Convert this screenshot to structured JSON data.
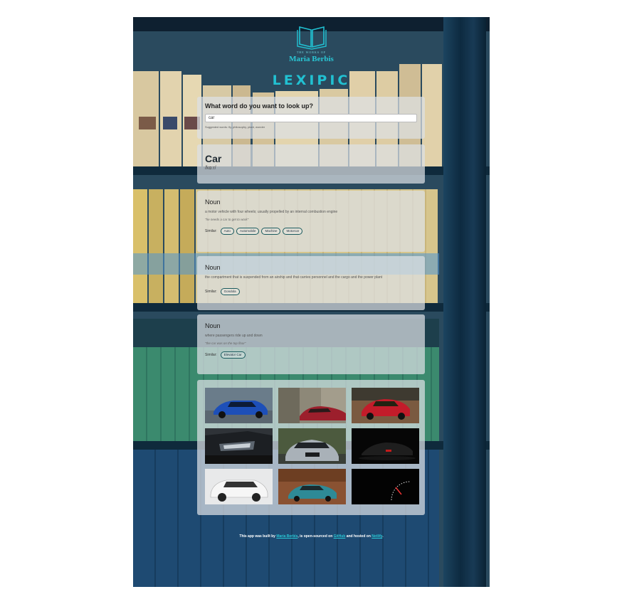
{
  "brand": {
    "small_text": "THE WORKS OF",
    "name": "Maria Berbis",
    "logo_icon": "open-book-icon",
    "color": "#21c1d2"
  },
  "title": "LEXIPIC",
  "search": {
    "question": "What word do you want to look up?",
    "value": "car",
    "suggestions": "Suggested words: fly, philosophy, plant, wonder"
  },
  "word": {
    "text": "Car",
    "phonetic": "/kɑːr/"
  },
  "definitions": [
    {
      "pos": "Noun",
      "definition": "a motor vehicle with four wheels; usually propelled by an internal combustion engine",
      "example": "\"he needs a car to get to work\"",
      "similar_label": "Similar:",
      "synonyms": [
        "Auto",
        "Automobile",
        "Machine",
        "Motorcar"
      ]
    },
    {
      "pos": "Noun",
      "definition": "the compartment that is suspended from an airship and that carries personnel and the cargo and the power plant",
      "example": "",
      "similar_label": "Similar:",
      "synonyms": [
        "Gondola"
      ]
    },
    {
      "pos": "Noun",
      "definition": "where passengers ride up and down",
      "example": "\"the car was on the top floor\"",
      "similar_label": "Similar:",
      "synonyms": [
        "Elevator Car"
      ]
    }
  ],
  "images": [
    {
      "icon": "blue-bmw-car-photo"
    },
    {
      "icon": "red-car-street-photo"
    },
    {
      "icon": "red-sports-car-photo"
    },
    {
      "icon": "car-headlight-photo"
    },
    {
      "icon": "silver-mercedes-photo"
    },
    {
      "icon": "dark-car-night-photo"
    },
    {
      "icon": "white-suv-photo"
    },
    {
      "icon": "teal-classic-car-photo"
    },
    {
      "icon": "speedometer-photo"
    }
  ],
  "footer": {
    "prefix": "This app was built by",
    "author": "Maria Berbis",
    "middle": ", is open-sourced on",
    "github": "GitHub",
    "middle2": "and hosted on",
    "host": "Netlify",
    "suffix": "."
  }
}
